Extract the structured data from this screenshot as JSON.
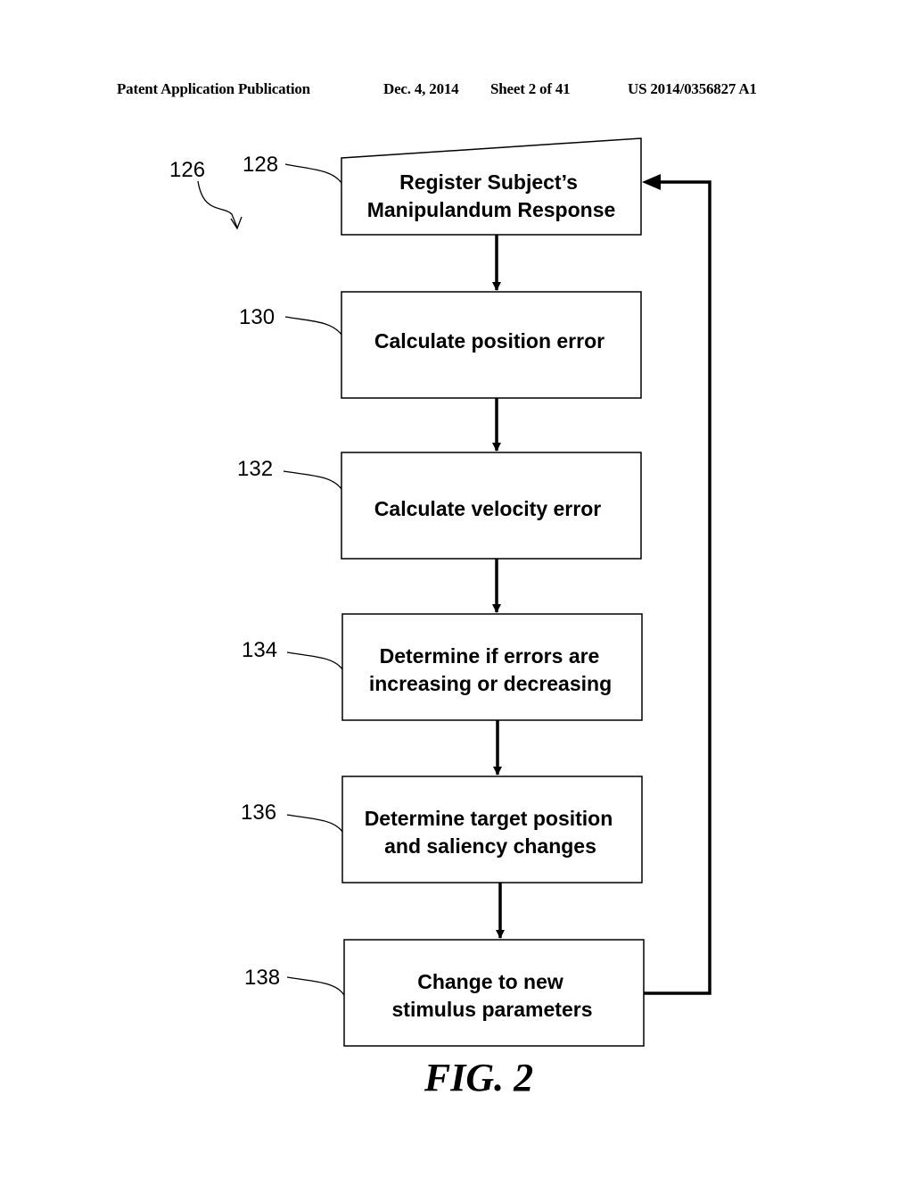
{
  "header": {
    "left": "Patent Application Publication",
    "date": "Dec. 4, 2014",
    "sheet": "Sheet 2 of 41",
    "number": "US 2014/0356827 A1"
  },
  "diagram": {
    "ref_main": "126",
    "steps": [
      {
        "ref": "128",
        "lines": [
          "Register Subject’s",
          "Manipulandum Response"
        ]
      },
      {
        "ref": "130",
        "lines": [
          "Calculate position error"
        ]
      },
      {
        "ref": "132",
        "lines": [
          "Calculate velocity error"
        ]
      },
      {
        "ref": "134",
        "lines": [
          "Determine if errors are",
          "increasing or decreasing"
        ]
      },
      {
        "ref": "136",
        "lines": [
          "Determine target position",
          "and saliency changes"
        ]
      },
      {
        "ref": "138",
        "lines": [
          "Change to new",
          "stimulus parameters"
        ]
      }
    ],
    "figure_label": "FIG. 2"
  }
}
